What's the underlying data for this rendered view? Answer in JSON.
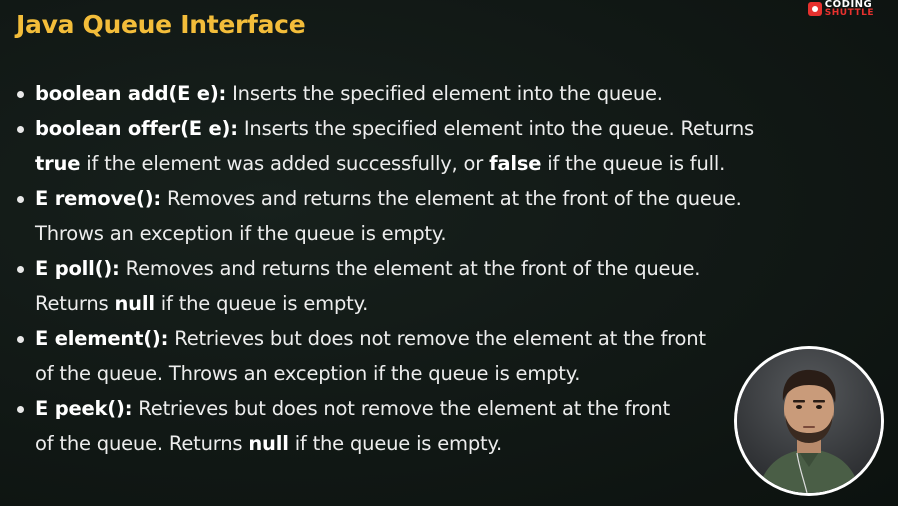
{
  "title": "Java Queue Interface",
  "logo": {
    "line1": "CODING",
    "line2": "SHUTTLE",
    "accent_color": "#e6312e"
  },
  "title_color": "#f3bd3a",
  "bullets": [
    {
      "sig": "boolean add(E e):",
      "t1": " Inserts the specified element into the queue."
    },
    {
      "sig": "boolean offer(E e):",
      "t1": " Inserts the specified element into the queue. Returns ",
      "kw1": "true",
      "t2": " if the element was added successfully, or ",
      "kw2": "false",
      "t3": " if the queue is full."
    },
    {
      "sig": "E remove():",
      "t1": " Removes and returns the element at the front of the queue. Throws an exception if the queue is empty."
    },
    {
      "sig": "E poll():",
      "t1": " Removes and returns the element at the front of the queue. Returns ",
      "kw1": "null",
      "t2": " if the queue is empty."
    },
    {
      "sig": "E element():",
      "t1": " Retrieves but does not remove the element at the front of the queue. Throws an exception if the queue is empty."
    },
    {
      "sig": "E peek():",
      "t1": " Retrieves but does not remove the element at the front of the queue. Returns ",
      "kw1": "null",
      "t2": " if the queue is empty."
    }
  ],
  "presenter": {
    "icon": "presenter-avatar"
  }
}
